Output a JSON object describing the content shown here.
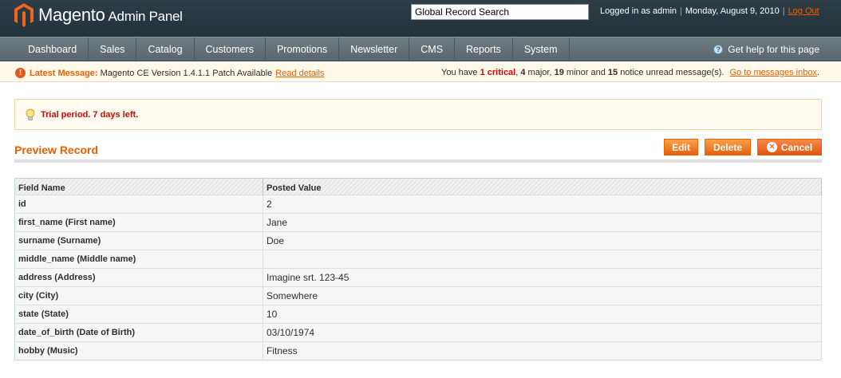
{
  "header": {
    "logo_main": "Magento",
    "logo_sub": "Admin Panel",
    "search_value": "Global Record Search",
    "logged_in": "Logged in as admin",
    "date": "Monday, August 9, 2010",
    "logout": "Log Out"
  },
  "nav": {
    "items": [
      "Dashboard",
      "Sales",
      "Catalog",
      "Customers",
      "Promotions",
      "Newsletter",
      "CMS",
      "Reports",
      "System"
    ],
    "help": "Get help for this page"
  },
  "notice": {
    "latest_label": "Latest Message:",
    "latest_text": "Magento CE Version 1.4.1.1 Patch Available",
    "read_details": "Read details",
    "prefix": "You have",
    "critical": "1 critical",
    "major_count": "4",
    "major": "major,",
    "minor_count": "19",
    "minor": "minor and",
    "notice_count": "15",
    "notice_text": "notice unread message(s).",
    "inbox_link": "Go to messages inbox",
    "inbox_suffix": "."
  },
  "trial": {
    "text": "Trial period. 7 days left."
  },
  "page": {
    "title": "Preview Record",
    "edit": "Edit",
    "delete": "Delete",
    "cancel": "Cancel"
  },
  "table": {
    "headers": [
      "Field Name",
      "Posted Value"
    ],
    "rows": [
      [
        "id",
        "2"
      ],
      [
        "first_name (First name)",
        "Jane"
      ],
      [
        "surname (Surname)",
        "Doe"
      ],
      [
        "middle_name (Middle name)",
        ""
      ],
      [
        "address (Address)",
        "Imagine srt. 123-45"
      ],
      [
        "city (City)",
        "Somewhere"
      ],
      [
        "state (State)",
        "10"
      ],
      [
        "date_of_birth (Date of Birth)",
        "03/10/1974"
      ],
      [
        "hobby (Music)",
        "Fitness"
      ]
    ]
  },
  "colors": {
    "accent": "#eb5e00",
    "critical": "#d40707",
    "header_bg": "#2e3e46",
    "nav_bg": "#65737a"
  }
}
